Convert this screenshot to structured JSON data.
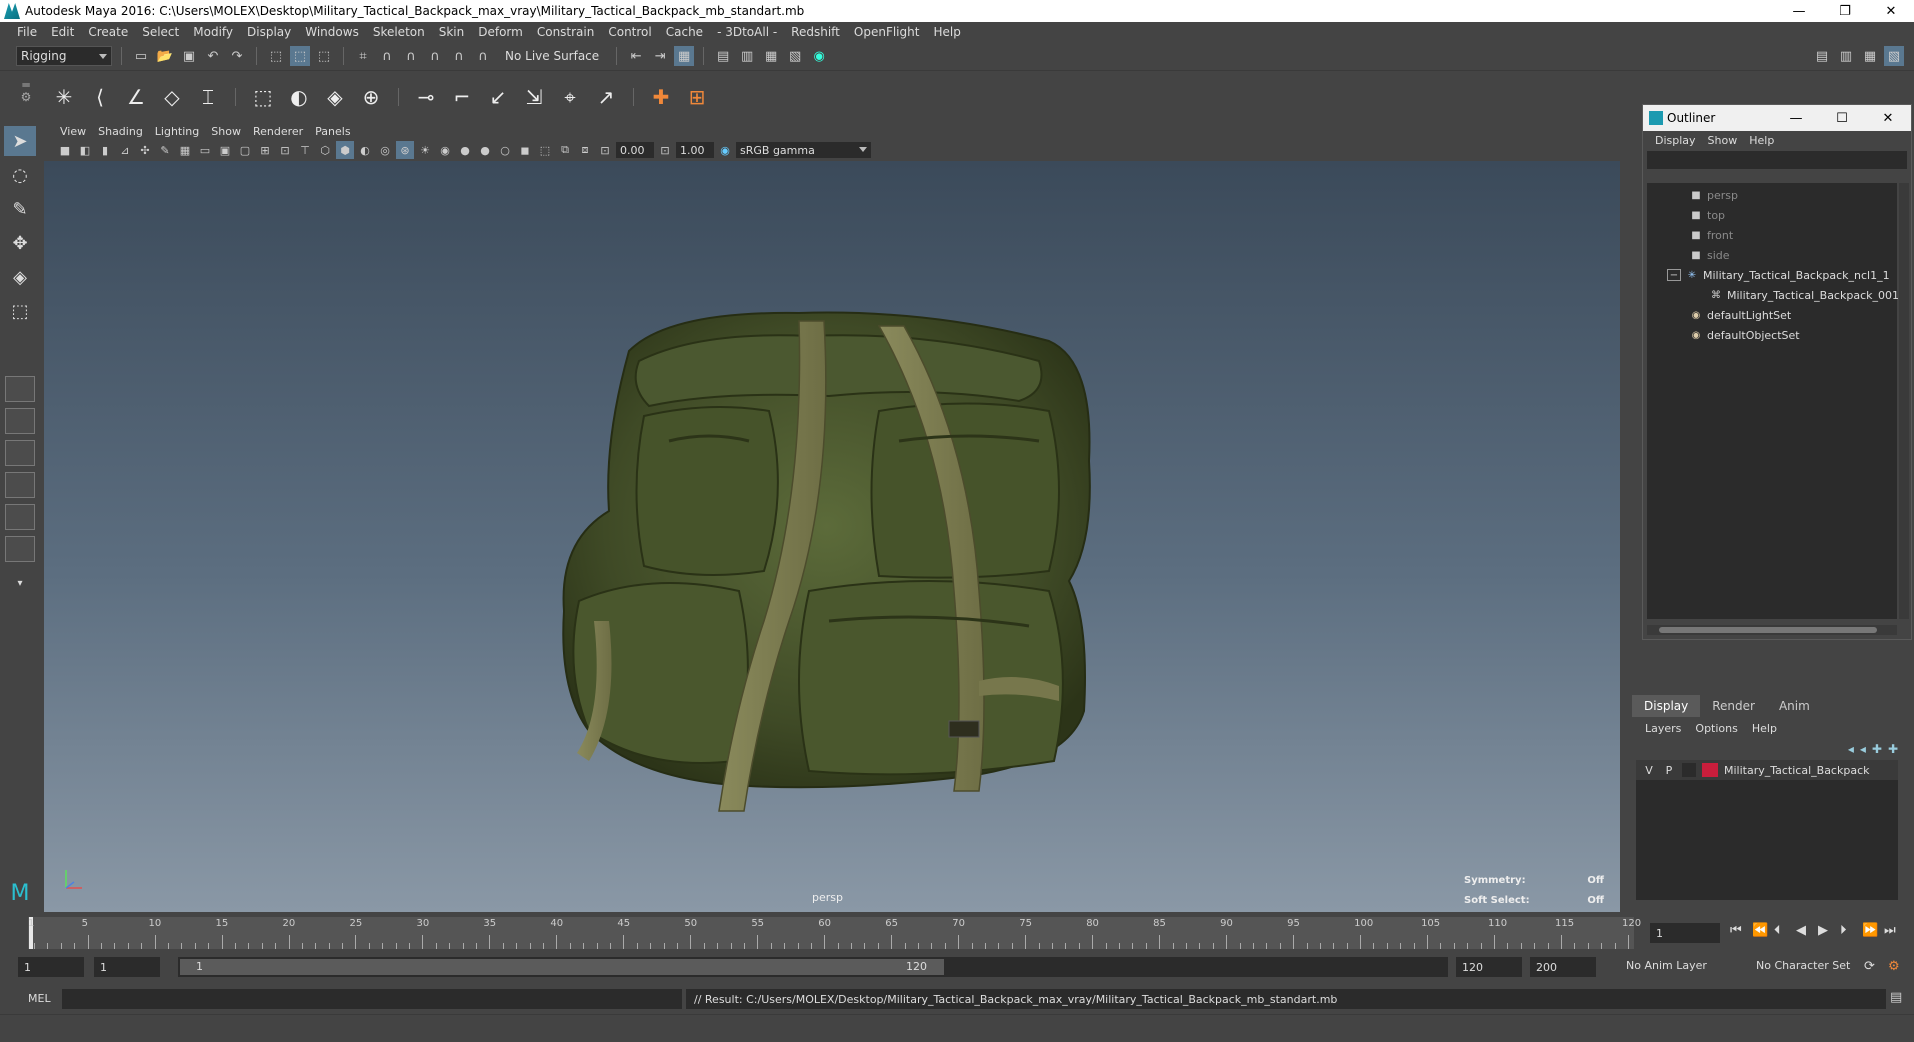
{
  "window": {
    "title": "Autodesk Maya 2016: C:\\Users\\MOLEX\\Desktop\\Military_Tactical_Backpack_max_vray\\Military_Tactical_Backpack_mb_standart.mb",
    "minimize": "—",
    "restore": "❐",
    "close": "✕"
  },
  "menubar": [
    "File",
    "Edit",
    "Create",
    "Select",
    "Modify",
    "Display",
    "Windows",
    "Skeleton",
    "Skin",
    "Deform",
    "Constrain",
    "Control",
    "Cache",
    "- 3DtoAll -",
    "Redshift",
    "OpenFlight",
    "Help"
  ],
  "statusline": {
    "menuset": "Rigging",
    "live_surface": "No Live Surface"
  },
  "panel": {
    "menu": [
      "View",
      "Shading",
      "Lighting",
      "Show",
      "Renderer",
      "Panels"
    ],
    "exposure": "0.00",
    "gamma": "1.00",
    "colorspace": "sRGB gamma"
  },
  "viewport": {
    "camera": "persp",
    "symmetry_label": "Symmetry:",
    "symmetry_value": "Off",
    "soft_select_label": "Soft Select:",
    "soft_select_value": "Off"
  },
  "outliner": {
    "title": "Outliner",
    "menu": [
      "Display",
      "Show",
      "Help"
    ],
    "items": [
      {
        "label": "persp",
        "icon": "camera-icon",
        "dim": true
      },
      {
        "label": "top",
        "icon": "camera-icon",
        "dim": true
      },
      {
        "label": "front",
        "icon": "camera-icon",
        "dim": true
      },
      {
        "label": "side",
        "icon": "camera-icon",
        "dim": true
      },
      {
        "label": "Military_Tactical_Backpack_ncl1_1",
        "icon": "joint-icon",
        "dim": false
      },
      {
        "label": "Military_Tactical_Backpack_001",
        "icon": "mesh-icon",
        "dim": false
      },
      {
        "label": "defaultLightSet",
        "icon": "set-icon",
        "dim": false
      },
      {
        "label": "defaultObjectSet",
        "icon": "set-icon",
        "dim": false
      }
    ]
  },
  "layers": {
    "tabs": [
      "Display",
      "Render",
      "Anim"
    ],
    "menu": [
      "Layers",
      "Options",
      "Help"
    ],
    "rows": [
      {
        "v": "V",
        "p": "P",
        "name": "Military_Tactical_Backpack",
        "color": "#c81e3c"
      }
    ]
  },
  "timeline": {
    "labels": [
      "1",
      "5",
      "10",
      "15",
      "20",
      "25",
      "30",
      "35",
      "40",
      "45",
      "50",
      "55",
      "60",
      "65",
      "70",
      "75",
      "80",
      "85",
      "90",
      "95",
      "100",
      "105",
      "110",
      "115",
      "120"
    ],
    "current_frame": "1"
  },
  "range": {
    "start": "1",
    "playback_start": "1",
    "bar_start": "1",
    "bar_end": "120",
    "playback_end": "120",
    "end": "200",
    "anim_layer": "No Anim Layer",
    "char_set": "No Character Set"
  },
  "cmdline": {
    "mode": "MEL",
    "result": "// Result: C:/Users/MOLEX/Desktop/Military_Tactical_Backpack_max_vray/Military_Tactical_Backpack_mb_standart.mb"
  }
}
